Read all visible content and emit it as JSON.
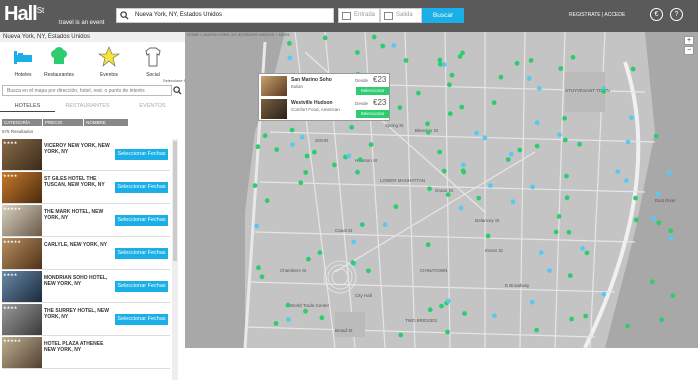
{
  "brand": {
    "name": "Hall",
    "sup": "St",
    "tagline": "travel is an event"
  },
  "search": {
    "value": "Nueva York, NY, Estados Unidos"
  },
  "dates": {
    "checkin_placeholder": "Entrada",
    "checkout_placeholder": "Salida"
  },
  "buscar": "Buscar",
  "toplinks": "REGISTRATE  |  ACCEDE",
  "currency": "€",
  "help": "?",
  "sidebar": {
    "location": "Nueva York, NY, Estados Unidos",
    "categories": [
      {
        "label": "Hoteles"
      },
      {
        "label": "Restaurantes"
      },
      {
        "label": "Eventos"
      },
      {
        "label": "Social"
      }
    ],
    "filter_label": "Seleccione filtros",
    "search_placeholder": "Busca en el mapa por dirección, hotel, rest. o punto de interés",
    "tabs": [
      {
        "label": "HOTELES"
      },
      {
        "label": "RESTAURANTES"
      },
      {
        "label": "EVENTOS"
      }
    ],
    "filters": [
      {
        "label": "CATEGORÍA"
      },
      {
        "label": "PRECIO"
      },
      {
        "label": "NOMBRE"
      }
    ],
    "results": "575 Resultados",
    "select_label": "Seleccionar Fechas",
    "hotels": [
      {
        "name": "VICEROY NEW YORK, NEW YORK, NY"
      },
      {
        "name": "ST GILES HOTEL THE TUSCAN, NEW YORK, NY"
      },
      {
        "name": "THE MARK HOTEL, NEW YORK, NY"
      },
      {
        "name": "CARLYLE, NEW YORK, NY"
      },
      {
        "name": "MONDRIAN SOHO HOTEL, NEW YORK, NY"
      },
      {
        "name": "THE SURREY HOTEL, NEW YORK, NY"
      },
      {
        "name": "HOTEL PLAZA ATHENEE NEW YORK, NY"
      }
    ]
  },
  "map": {
    "breadcrumb": "HOME > NUEVA YORK, NY, ESTADOS UNIDOS > MAPA",
    "labels": [
      "Spring St",
      "Canal St",
      "Chambers St",
      "World Trade Center",
      "Broad St",
      "CHINATOWN",
      "SOHO",
      "STUYVESANT TOWN",
      "East River",
      "Bleecker St",
      "Houston St",
      "City Hall",
      "LOWER MANHATTAN",
      "TWO BRIDGES",
      "Grand St",
      "Delancey St",
      "Essex St",
      "E Broadway"
    ],
    "zoom_in": "+",
    "zoom_out": "−"
  },
  "popup": {
    "items": [
      {
        "name": "San Marino Soho",
        "category": "Italian",
        "from": "Desde",
        "price": "€23",
        "select": "Seleccionar"
      },
      {
        "name": "Westville Hudson",
        "category": "Comfort Food, American",
        "from": "Desde",
        "price": "€23",
        "select": "Seleccionar"
      }
    ]
  },
  "colors": {
    "accent": "#1aafe6",
    "green": "#2ecc71",
    "topbar": "#5a5a5a"
  }
}
